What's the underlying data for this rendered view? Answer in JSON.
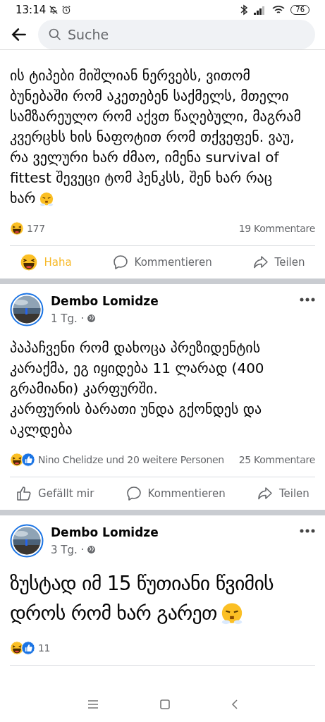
{
  "status_bar": {
    "time": "13:14",
    "battery": "76"
  },
  "search": {
    "placeholder": "Suche"
  },
  "posts": [
    {
      "text": "ის ტიპები მიშლიან ნერვებს, ვითომ ბუნებაში რომ აკეთებენ საქმელს, მთელი სამზარეულო რომ აქვთ წაღებული, მაგრამ კვერცხს ხის ნაფოტით რომ თქვეფენ. ვაუ, რა ველური ხარ ძმაო, იმენა survival of fittest შევეცი ტომ ჰენკსს, შენ ხარ რაც ხარ",
      "large": false,
      "emoji": true,
      "reactions": [
        {
          "kind": "haha"
        }
      ],
      "reaction_text": "177",
      "comments": "19 Kommentare",
      "actions": [
        {
          "kind": "haha",
          "label": "Haha",
          "selected": true
        },
        {
          "kind": "comment",
          "label": "Kommentieren",
          "selected": false
        },
        {
          "kind": "share",
          "label": "Teilen",
          "selected": false
        }
      ]
    },
    {
      "header": {
        "author": "Dembo Lomidze",
        "time": "1 Tg. ·"
      },
      "text": "პაპაჩვენი რომ დახოცა პრეზიდენტის კარაქმა, ეგ იყიდება 11 ლარად (400 გრამიანი) კარფურში.\nკარფურის ბარათი უნდა გქონდეს და აკლდება",
      "large": false,
      "emoji": false,
      "reactions": [
        {
          "kind": "haha"
        },
        {
          "kind": "like"
        }
      ],
      "reaction_text": "Nino Chelidze und 20 weitere Personen",
      "comments": "25 Kommentare",
      "actions": [
        {
          "kind": "like",
          "label": "Gefällt mir",
          "selected": false
        },
        {
          "kind": "comment",
          "label": "Kommentieren",
          "selected": false
        },
        {
          "kind": "share",
          "label": "Teilen",
          "selected": false
        }
      ]
    },
    {
      "header": {
        "author": "Dembo Lomidze",
        "time": "3 Tg. ·"
      },
      "text": "ზუსტად იმ 15 წუთიანი წვიმის დროს რომ ხარ გარეთ",
      "large": true,
      "emoji": true,
      "reactions": [
        {
          "kind": "haha"
        },
        {
          "kind": "like"
        }
      ],
      "reaction_text": "11"
    }
  ]
}
